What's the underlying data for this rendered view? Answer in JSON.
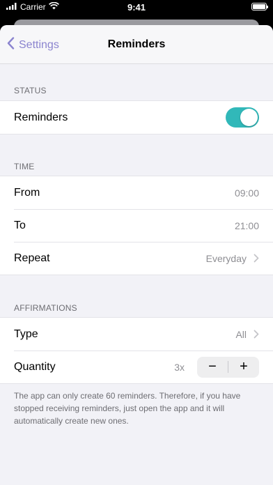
{
  "status_bar": {
    "carrier": "Carrier",
    "time": "9:41"
  },
  "nav": {
    "back_label": "Settings",
    "title": "Reminders"
  },
  "status_section": {
    "header": "STATUS",
    "reminders_label": "Reminders",
    "reminders_on": true
  },
  "time_section": {
    "header": "TIME",
    "from_label": "From",
    "from_value": "09:00",
    "to_label": "To",
    "to_value": "21:00",
    "repeat_label": "Repeat",
    "repeat_value": "Everyday"
  },
  "affirmations_section": {
    "header": "AFFIRMATIONS",
    "type_label": "Type",
    "type_value": "All",
    "quantity_label": "Quantity",
    "quantity_value": "3x",
    "minus": "−",
    "plus": "+"
  },
  "footer_note": "The app can only create 60 reminders. Therefore, if you have stopped receiving reminders, just open the app and it will automatically create new ones.",
  "colors": {
    "accent": "#8b84cf",
    "toggle_on": "#31b8b9"
  },
  "icons": [
    "signal-icon",
    "wifi-icon",
    "battery-icon",
    "chevron-left-icon",
    "chevron-right-icon"
  ]
}
